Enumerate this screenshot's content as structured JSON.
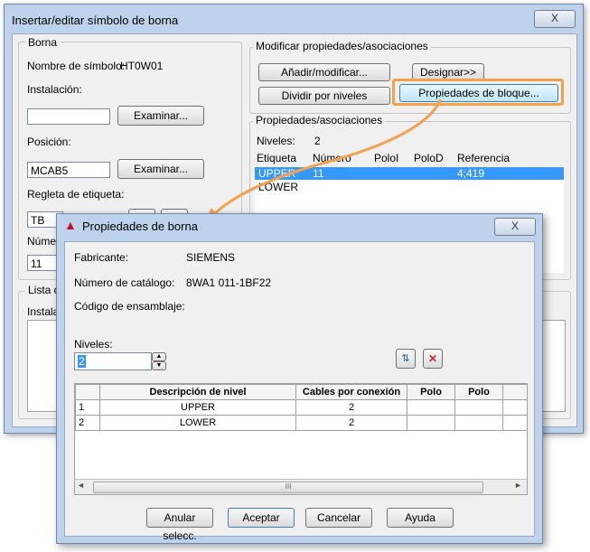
{
  "back_window": {
    "title": "Insertar/editar símbolo de borna",
    "close": "X",
    "borna": {
      "group": "Borna",
      "symbol_name_label": "Nombre de símbolo:",
      "symbol_name_value": "HT0W01",
      "installation_label": "Instalación:",
      "installation_value": "",
      "browse1": "Examinar...",
      "position_label": "Posición:",
      "position_value": "MCAB5",
      "browse2": "Examinar...",
      "strip_label": "Regleta de etiqueta:",
      "strip_value": "TB",
      "number_label_part": "Númer",
      "number_value": "11"
    },
    "list_group_part": "Lista de",
    "install_part": "Instalac",
    "modify": {
      "group": "Modificar propiedades/asociaciones",
      "add_modify": "Añadir/modificar...",
      "assign": "Designar>>",
      "split_levels": "Dividir por niveles",
      "block_props": "Propiedades de bloque..."
    },
    "props": {
      "group": "Propiedades/asociaciones",
      "levels_label": "Niveles:",
      "levels_value": "2",
      "headers": [
        "Etiqueta",
        "Número",
        "PoloI",
        "PoloD",
        "Referencia"
      ],
      "rows": [
        {
          "label": "UPPER",
          "number": "11",
          "ref": "4;419"
        },
        {
          "label": "LOWER",
          "number": "",
          "ref": ""
        }
      ]
    }
  },
  "dialog": {
    "title": "Propiedades de borna",
    "close": "X",
    "manufacturer_label": "Fabricante:",
    "manufacturer_value": "SIEMENS",
    "catalog_label": "Número de catálogo:",
    "catalog_value": "8WA1 011-1BF22",
    "assembly_label": "Código de ensamblaje:",
    "levels_label": "Niveles:",
    "levels_value": "2",
    "table_headers": [
      "Descripción de nivel",
      "Cables por conexión",
      "Polo",
      "Polo"
    ],
    "table_rows": [
      {
        "num": "1",
        "desc": "UPPER",
        "wires": "2"
      },
      {
        "num": "2",
        "desc": "LOWER",
        "wires": "2"
      }
    ],
    "scroll_grip": "III",
    "buttons": {
      "cancel_select": "Anular selecc.",
      "accept": "Aceptar",
      "cancel": "Cancelar",
      "help": "Ayuda"
    }
  },
  "colors": {
    "highlight": "#3399ff",
    "callout": "#f5a04a",
    "window_frame": "#bed3eb"
  }
}
